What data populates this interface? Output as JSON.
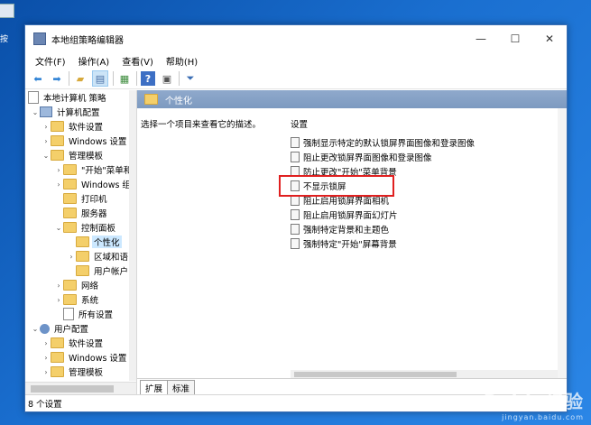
{
  "desktop": {
    "icon_label": "按"
  },
  "window": {
    "title": "本地组策略编辑器",
    "controls": {
      "minimize": "—",
      "maximize": "☐",
      "close": "✕"
    }
  },
  "menu": [
    "文件(F)",
    "操作(A)",
    "查看(V)",
    "帮助(H)"
  ],
  "tree": {
    "root": "本地计算机 策略",
    "items": [
      "计算机配置",
      "软件设置",
      "Windows 设置",
      "管理模板",
      "\"开始\"菜单和",
      "Windows 组",
      "打印机",
      "服务器",
      "控制面板",
      "个性化",
      "区域和语",
      "用户帐户",
      "网络",
      "系统",
      "所有设置",
      "用户配置",
      "软件设置",
      "Windows 设置",
      "管理模板"
    ]
  },
  "right": {
    "header": "个性化",
    "description": "选择一个项目来查看它的描述。",
    "settings_header": "设置",
    "settings": [
      "强制显示特定的默认锁屏界面图像和登录图像",
      "阻止更改锁屏界面图像和登录图像",
      "防止更改\"开始\"菜单背景",
      "不显示锁屏",
      "阻止启用锁屏界面相机",
      "阻止启用锁屏界面幻灯片",
      "强制特定背景和主题色",
      "强制特定\"开始\"屏幕背景"
    ],
    "tabs": [
      "扩展",
      "标准"
    ]
  },
  "status": "8 个设置",
  "watermark": {
    "main": "Baidu经验",
    "sub": "jingyan.baidu.com"
  },
  "colors": {
    "highlight": "#e02020",
    "header_bg": "#8fa9cc",
    "desktop": "#1a6fd0"
  }
}
